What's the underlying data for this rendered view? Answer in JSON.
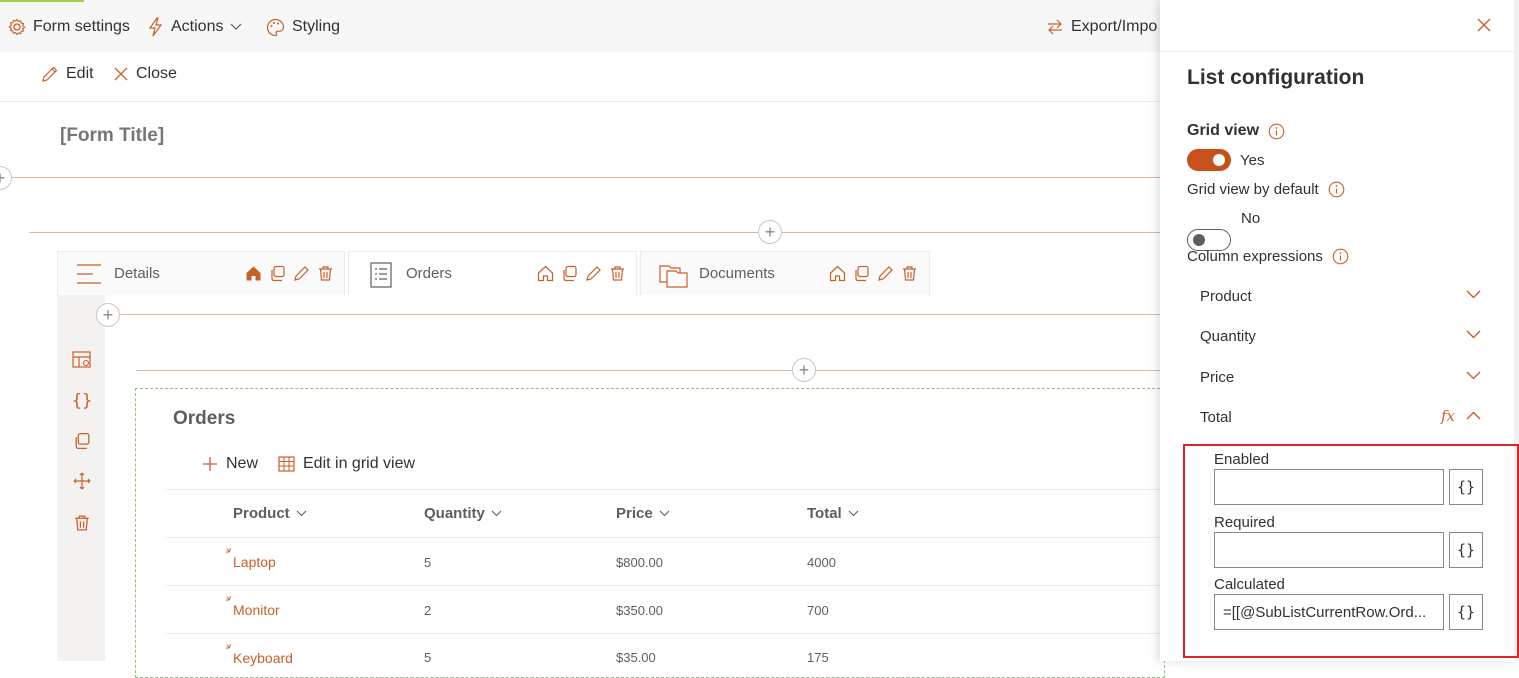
{
  "colors": {
    "accent": "#c8602a",
    "toggle_on": "#c8501a",
    "highlight_border": "#d9262b",
    "dashed_border": "#8fc27a"
  },
  "topbar": {
    "form_settings": {
      "label": "Form settings",
      "icon": "gear-icon"
    },
    "actions": {
      "label": "Actions",
      "icon": "lightning-icon"
    },
    "styling": {
      "label": "Styling",
      "icon": "palette-icon"
    },
    "export_import": {
      "label": "Export/Impo",
      "icon": "arrows-exchange-icon"
    }
  },
  "cmdbar": {
    "edit": {
      "label": "Edit",
      "icon": "pencil-icon"
    },
    "close": {
      "label": "Close",
      "icon": "close-icon"
    }
  },
  "form_title": "[Form Title]",
  "tabs": [
    {
      "label": "Details",
      "icon": "hamburger-icon",
      "active": false
    },
    {
      "label": "Orders",
      "icon": "document-list-icon",
      "active": true
    },
    {
      "label": "Documents",
      "icon": "folders-icon",
      "active": false
    }
  ],
  "orders": {
    "title": "Orders",
    "new_label": "New",
    "grid_view_label": "Edit in grid view",
    "columns": [
      "Product",
      "Quantity",
      "Price",
      "Total"
    ],
    "rows": [
      {
        "product": "Laptop",
        "quantity": "5",
        "price": "$800.00",
        "total": "4000"
      },
      {
        "product": "Monitor",
        "quantity": "2",
        "price": "$350.00",
        "total": "700"
      },
      {
        "product": "Keyboard",
        "quantity": "5",
        "price": "$35.00",
        "total": "175"
      }
    ]
  },
  "panel": {
    "title": "List configuration",
    "grid_view": {
      "label": "Grid view",
      "value": "Yes",
      "on": true
    },
    "grid_view_default": {
      "label": "Grid view by default",
      "value": "No",
      "on": false
    },
    "column_expressions": {
      "label": "Column expressions",
      "items": [
        {
          "label": "Product",
          "expanded": false
        },
        {
          "label": "Quantity",
          "expanded": false
        },
        {
          "label": "Price",
          "expanded": false
        },
        {
          "label": "Total",
          "expanded": true,
          "fx_label": "fx"
        }
      ]
    },
    "fields": {
      "enabled": {
        "label": "Enabled",
        "value": "",
        "button": "{}"
      },
      "required": {
        "label": "Required",
        "value": "",
        "button": "{}"
      },
      "calculated": {
        "label": "Calculated",
        "value": "=[[@SubListCurrentRow.Ord...",
        "button": "{}"
      }
    }
  }
}
